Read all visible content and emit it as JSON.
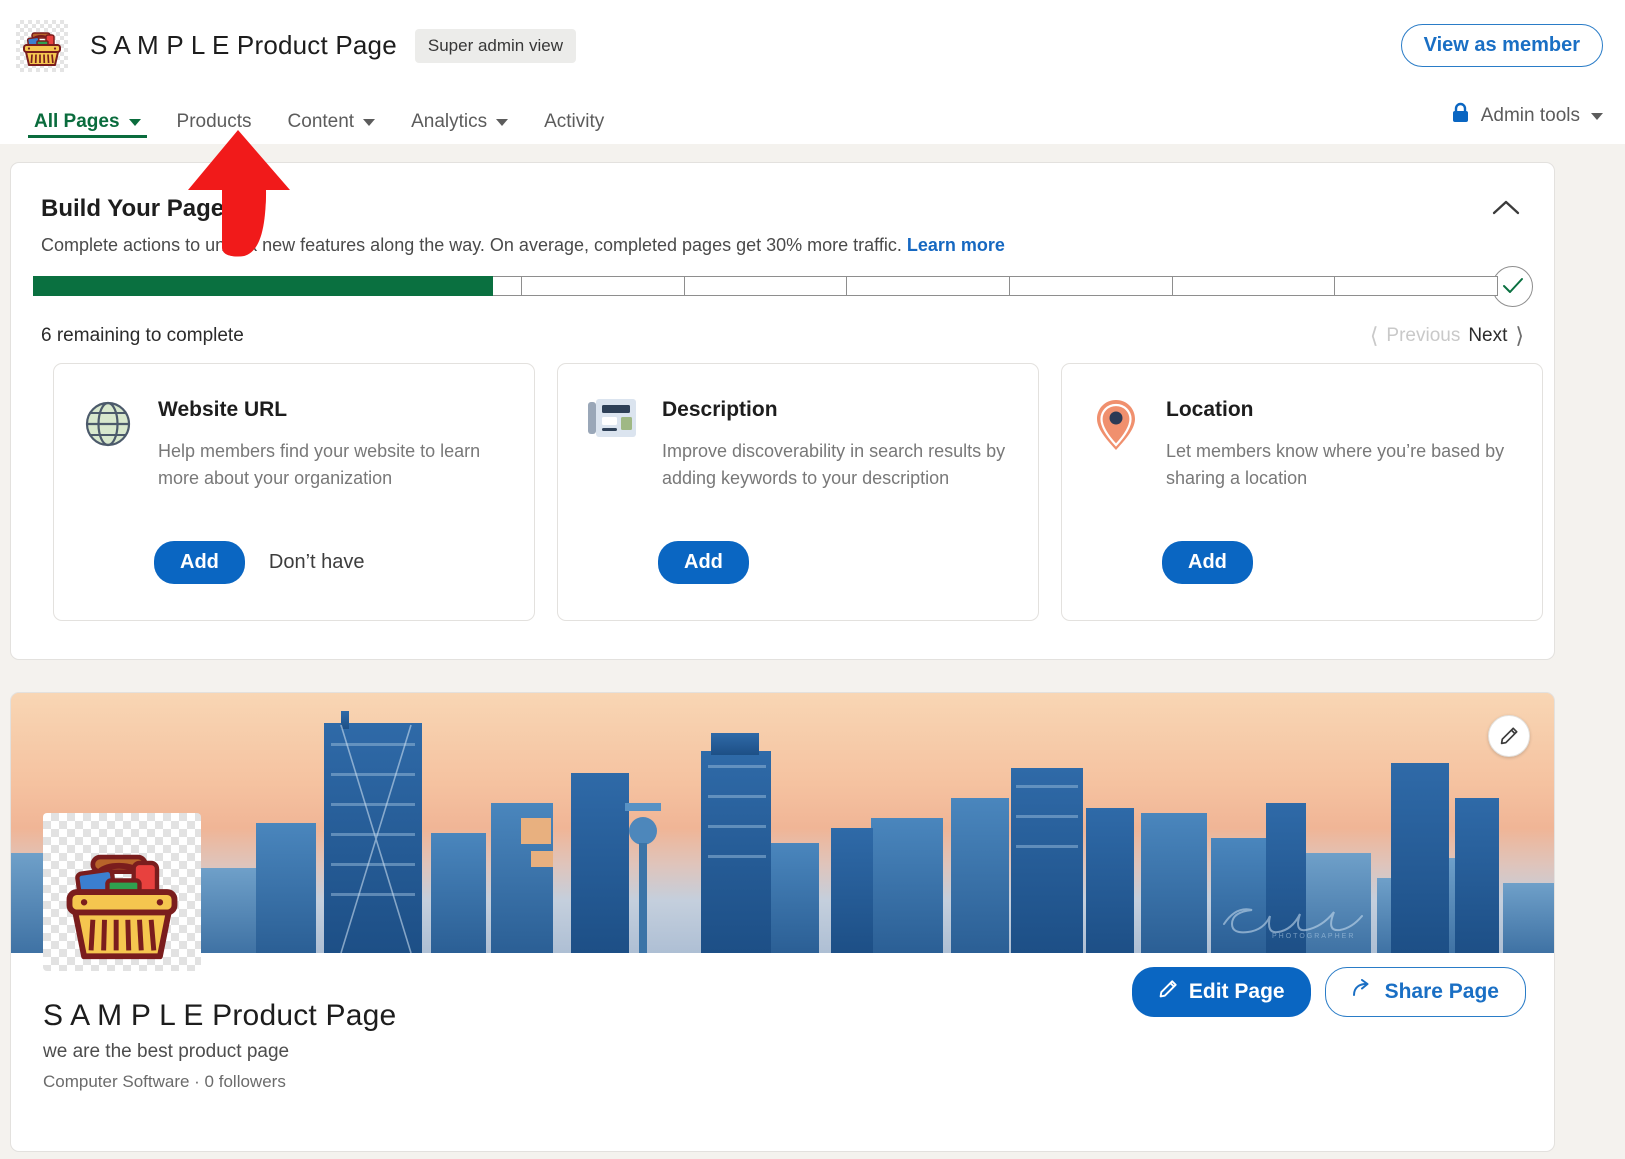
{
  "header": {
    "logo_icon": "shopping-basket-icon",
    "title": "S A M P L E Product Page",
    "admin_badge": "Super admin view",
    "view_as_member": "View as member"
  },
  "nav": {
    "items": [
      {
        "label": "All Pages",
        "has_caret": true,
        "active": true
      },
      {
        "label": "Products",
        "has_caret": false,
        "active": false
      },
      {
        "label": "Content",
        "has_caret": true,
        "active": false
      },
      {
        "label": "Analytics",
        "has_caret": true,
        "active": false
      },
      {
        "label": "Activity",
        "has_caret": false,
        "active": false
      }
    ],
    "admin_tools": "Admin tools",
    "admin_tools_icon": "lock-icon"
  },
  "build": {
    "title": "Build Your Page",
    "subtitle_prefix": "Complete actions to unlock new features along the way. On average, completed pages get 30% more traffic. ",
    "learn_more": "Learn more",
    "collapse_icon": "chevron-up-icon",
    "progress": {
      "segments_total": 9,
      "segments_complete": 2,
      "segment_partial_fraction": 0.83,
      "check_icon": "check-icon"
    },
    "remaining_text": "6 remaining to complete",
    "pager": {
      "previous": "Previous",
      "next": "Next"
    },
    "tasks": [
      {
        "icon": "globe-icon",
        "name": "Website URL",
        "description": "Help members find your website to learn more about your organization",
        "primary_action": "Add",
        "secondary_action": "Don’t have"
      },
      {
        "icon": "article-icon",
        "name": "Description",
        "description": "Improve discoverability in search results by adding keywords to your description",
        "primary_action": "Add",
        "secondary_action": null
      },
      {
        "icon": "map-pin-icon",
        "name": "Location",
        "description": "Let members know where you’re based by sharing a location",
        "primary_action": "Add",
        "secondary_action": null
      }
    ]
  },
  "profile": {
    "banner_edit_icon": "pencil-icon",
    "avatar_icon": "shopping-basket-icon",
    "name": "S A M P L E Product Page",
    "tagline": "we are the best product page",
    "meta": "Computer Software · 0 followers",
    "edit_page": "Edit Page",
    "share_page": "Share Page",
    "edit_icon": "pencil-icon",
    "share_icon": "share-arrow-icon"
  },
  "annotation": {
    "arrow": "red-up-arrow",
    "color": "#f11a1a"
  },
  "colors": {
    "brand_blue": "#0a66c2",
    "progress_green": "#0a7040",
    "active_nav_green": "#0a6c3d",
    "link_blue": "#1668c1",
    "page_bg": "#f4f2ee"
  }
}
